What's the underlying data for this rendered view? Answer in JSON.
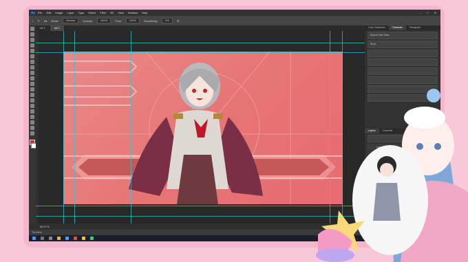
{
  "app": {
    "name": "Ps",
    "menu": [
      "File",
      "Edit",
      "Image",
      "Layer",
      "Type",
      "Select",
      "Filter",
      "3D",
      "View",
      "Window",
      "Help"
    ]
  },
  "options_bar": {
    "mode_label": "Mode:",
    "mode_value": "Normal",
    "opacity_label": "Opacity:",
    "opacity_value": "100%",
    "flow_label": "Flow:",
    "flow_value": "100%",
    "smoothing_label": "Smoothing:",
    "smoothing_value": "0%"
  },
  "document_tabs": [
    {
      "label": "tab 1"
    },
    {
      "label": "tab 2",
      "active": true
    }
  ],
  "panels": {
    "top_tabs": [
      "Color Swatches",
      "Character",
      "Paragraph"
    ],
    "font_family": "Source Han Sans",
    "font_size": "36 pt",
    "layers_tabs": [
      "Layers",
      "Channels"
    ],
    "layer_names": [
      "Layer 1",
      "Layer 2",
      "Layer 3",
      "Layer 4",
      "Layer 5",
      "Background"
    ]
  },
  "status": {
    "zoom": "66.67%",
    "timeline_label": "Timeline"
  },
  "taskbar": {
    "clock": "00:00"
  },
  "colors": {
    "canvas_bg": "#e77474",
    "guide": "#27c9d6",
    "frame_pink": "#f4b6cc",
    "page_pink": "#f8c8d8"
  }
}
